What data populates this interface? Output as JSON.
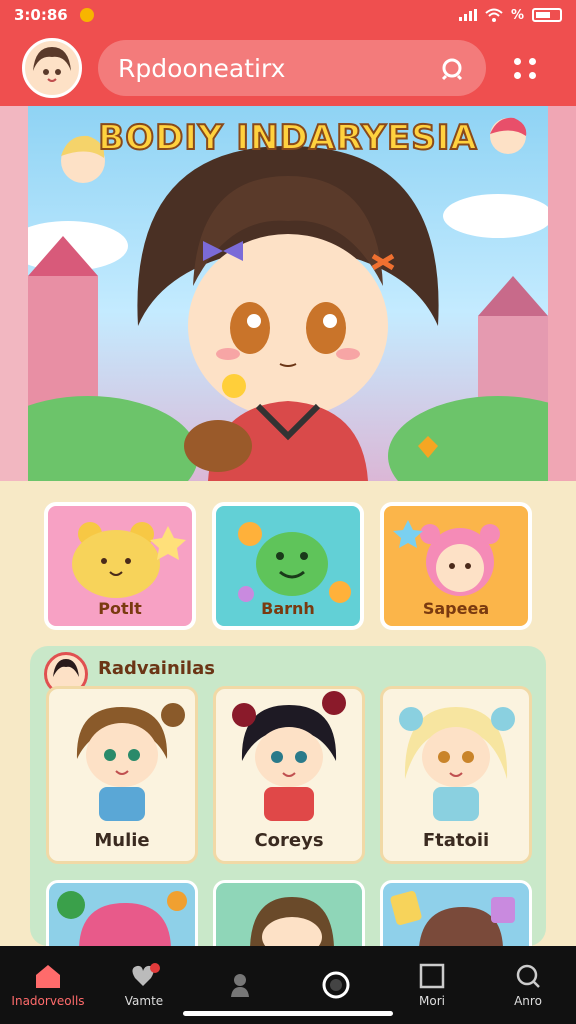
{
  "status": {
    "time": "3:0:86",
    "battery": "%"
  },
  "header": {
    "search_text": "Rpdooneatirx"
  },
  "hero": {
    "title": "BODIY INDARYESIA"
  },
  "categories": [
    {
      "label": "Potlt"
    },
    {
      "label": "Barnh"
    },
    {
      "label": "Sapeea"
    }
  ],
  "section": {
    "title": "Radvainilas"
  },
  "characters": [
    {
      "name": "Mulie"
    },
    {
      "name": "Coreys"
    },
    {
      "name": "Ftatoii"
    }
  ],
  "nav": [
    {
      "label": "Inadorveolls",
      "icon": "home-icon"
    },
    {
      "label": "Vamte",
      "icon": "heart-icon"
    },
    {
      "label": "",
      "icon": "person-icon"
    },
    {
      "label": "",
      "icon": "record-icon"
    },
    {
      "label": "Mori",
      "icon": "square-icon"
    },
    {
      "label": "Anro",
      "icon": "search-icon"
    }
  ],
  "colors": {
    "brand": "#ef4f4f",
    "nav_bg": "#111111",
    "active": "#ff6b6b"
  }
}
